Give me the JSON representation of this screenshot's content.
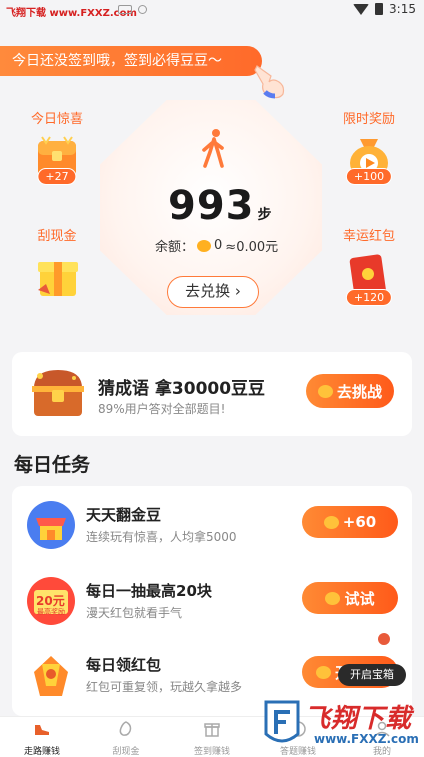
{
  "status_bar": {
    "brand": "飞翔下载 www.FXXZ.com",
    "time": "3:15"
  },
  "banner": {
    "text": "今日还没签到哦，签到必得豆豆～"
  },
  "side_rewards": {
    "today_surprise": {
      "label": "今日惊喜",
      "badge": "+27"
    },
    "limited_reward": {
      "label": "限时奖励",
      "badge": "+100"
    },
    "scratch_cash": {
      "label": "刮现金"
    },
    "lucky_packet": {
      "label": "幸运红包",
      "badge": "+120"
    }
  },
  "center": {
    "steps": "993",
    "steps_unit": "步",
    "balance_label": "余额：",
    "balance_beans": "0",
    "balance_approx": "≈0.00元",
    "exchange_button": "去兑换"
  },
  "idiom_card": {
    "title": "猜成语 拿30000豆豆",
    "subtitle": "89%用户答对全部题目!",
    "button": "去挑战"
  },
  "daily_tasks": {
    "section_title": "每日任务",
    "tasks": [
      {
        "title": "天天翻金豆",
        "subtitle": "连续玩有惊喜，人均拿5000",
        "button": "+60",
        "icon": "shop-icon"
      },
      {
        "title": "每日一抽最高20块",
        "subtitle": "漫天红包就看手气",
        "button": "试试",
        "icon": "red-packet-icon",
        "icon_text_top": "20元",
        "icon_text_bottom": "最高奖励"
      },
      {
        "title": "每日领红包",
        "subtitle": "红包可重复领，玩越久拿越多",
        "button": "开",
        "icon": "gift-packet-icon"
      }
    ]
  },
  "floating": {
    "treasure_label": "开启宝箱"
  },
  "tabbar": {
    "tabs": [
      {
        "label": "走路赚钱",
        "icon": "shoe-icon",
        "active": true
      },
      {
        "label": "刮现金",
        "icon": "scratch-icon",
        "active": false
      },
      {
        "label": "签到赚钱",
        "icon": "gift-icon",
        "active": false
      },
      {
        "label": "答题赚钱",
        "icon": "quiz-icon",
        "active": false
      },
      {
        "label": "我的",
        "icon": "profile-icon",
        "active": false
      }
    ]
  },
  "watermark": {
    "title": "飞翔下载",
    "url": "www.FXXZ.com"
  },
  "colors": {
    "accent": "#ff6a2a",
    "accent_light": "#ff8a34",
    "bean": "#ffb020",
    "background": "#f4f4f6"
  }
}
